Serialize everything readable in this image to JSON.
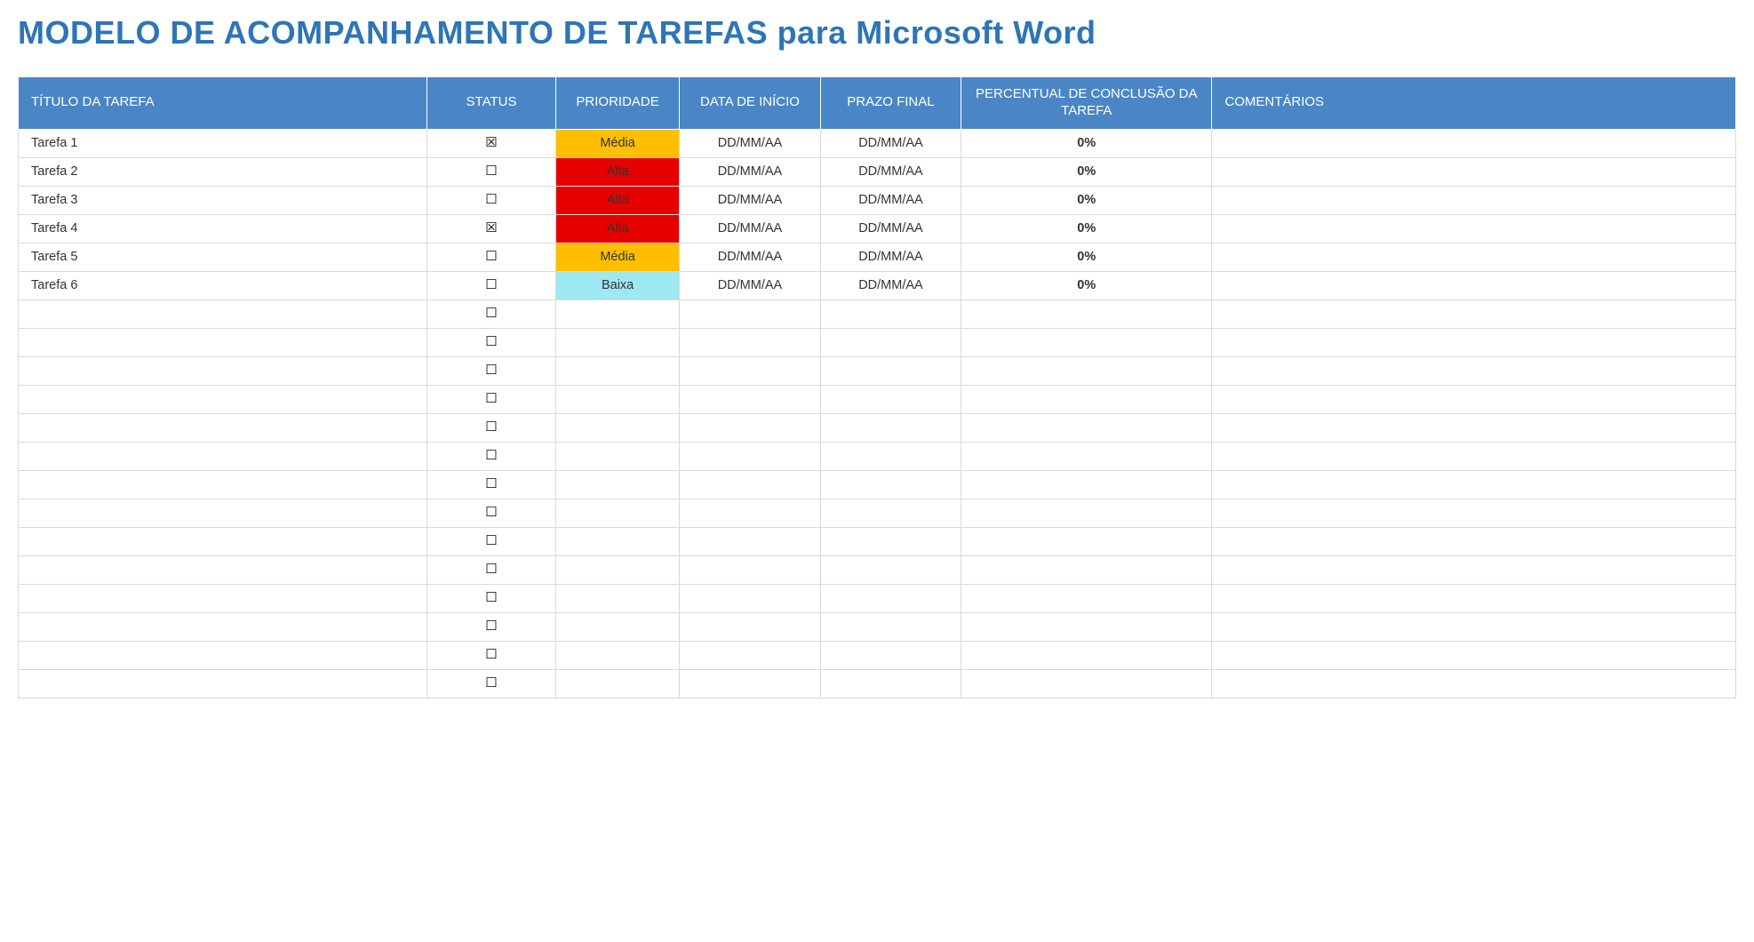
{
  "title": "MODELO DE ACOMPANHAMENTO DE TAREFAS para Microsoft Word",
  "colors": {
    "header_bg": "#4A86C5",
    "title_color": "#2E75B6",
    "priority": {
      "media": "#FFBF00",
      "alta": "#E60000",
      "baixa": "#9EE8F2"
    }
  },
  "headers": {
    "title": "TÍTULO DA TAREFA",
    "status": "STATUS",
    "priority": "PRIORIDADE",
    "start": "DATA DE INÍCIO",
    "due": "PRAZO FINAL",
    "percent": "PERCENTUAL DE CONCLUSÃO DA TAREFA",
    "comments": "COMENTÁRIOS"
  },
  "glyphs": {
    "checked": "☒",
    "unchecked": "☐"
  },
  "rows": [
    {
      "title": "Tarefa 1",
      "checked": true,
      "priority": "Média",
      "priority_key": "media",
      "start": "DD/MM/AA",
      "due": "DD/MM/AA",
      "percent": "0%",
      "comments": ""
    },
    {
      "title": "Tarefa 2",
      "checked": false,
      "priority": "Alta",
      "priority_key": "alta",
      "start": "DD/MM/AA",
      "due": "DD/MM/AA",
      "percent": "0%",
      "comments": ""
    },
    {
      "title": "Tarefa 3",
      "checked": false,
      "priority": "Alta",
      "priority_key": "alta",
      "start": "DD/MM/AA",
      "due": "DD/MM/AA",
      "percent": "0%",
      "comments": ""
    },
    {
      "title": "Tarefa 4",
      "checked": true,
      "priority": "Alta",
      "priority_key": "alta",
      "start": "DD/MM/AA",
      "due": "DD/MM/AA",
      "percent": "0%",
      "comments": ""
    },
    {
      "title": "Tarefa 5",
      "checked": false,
      "priority": "Média",
      "priority_key": "media",
      "start": "DD/MM/AA",
      "due": "DD/MM/AA",
      "percent": "0%",
      "comments": ""
    },
    {
      "title": "Tarefa 6",
      "checked": false,
      "priority": "Baixa",
      "priority_key": "baixa",
      "start": "DD/MM/AA",
      "due": "DD/MM/AA",
      "percent": "0%",
      "comments": ""
    },
    {
      "title": "",
      "checked": false,
      "priority": "",
      "priority_key": "",
      "start": "",
      "due": "",
      "percent": "",
      "comments": ""
    },
    {
      "title": "",
      "checked": false,
      "priority": "",
      "priority_key": "",
      "start": "",
      "due": "",
      "percent": "",
      "comments": ""
    },
    {
      "title": "",
      "checked": false,
      "priority": "",
      "priority_key": "",
      "start": "",
      "due": "",
      "percent": "",
      "comments": ""
    },
    {
      "title": "",
      "checked": false,
      "priority": "",
      "priority_key": "",
      "start": "",
      "due": "",
      "percent": "",
      "comments": ""
    },
    {
      "title": "",
      "checked": false,
      "priority": "",
      "priority_key": "",
      "start": "",
      "due": "",
      "percent": "",
      "comments": ""
    },
    {
      "title": "",
      "checked": false,
      "priority": "",
      "priority_key": "",
      "start": "",
      "due": "",
      "percent": "",
      "comments": ""
    },
    {
      "title": "",
      "checked": false,
      "priority": "",
      "priority_key": "",
      "start": "",
      "due": "",
      "percent": "",
      "comments": ""
    },
    {
      "title": "",
      "checked": false,
      "priority": "",
      "priority_key": "",
      "start": "",
      "due": "",
      "percent": "",
      "comments": ""
    },
    {
      "title": "",
      "checked": false,
      "priority": "",
      "priority_key": "",
      "start": "",
      "due": "",
      "percent": "",
      "comments": ""
    },
    {
      "title": "",
      "checked": false,
      "priority": "",
      "priority_key": "",
      "start": "",
      "due": "",
      "percent": "",
      "comments": ""
    },
    {
      "title": "",
      "checked": false,
      "priority": "",
      "priority_key": "",
      "start": "",
      "due": "",
      "percent": "",
      "comments": ""
    },
    {
      "title": "",
      "checked": false,
      "priority": "",
      "priority_key": "",
      "start": "",
      "due": "",
      "percent": "",
      "comments": ""
    },
    {
      "title": "",
      "checked": false,
      "priority": "",
      "priority_key": "",
      "start": "",
      "due": "",
      "percent": "",
      "comments": ""
    },
    {
      "title": "",
      "checked": false,
      "priority": "",
      "priority_key": "",
      "start": "",
      "due": "",
      "percent": "",
      "comments": ""
    }
  ]
}
